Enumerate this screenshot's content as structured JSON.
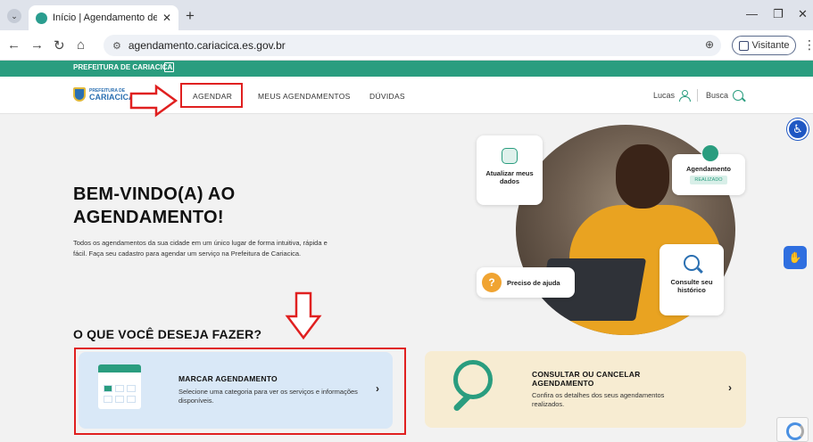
{
  "browser": {
    "tab_title": "Início | Agendamento de Cariac",
    "url": "agendamento.cariacica.es.gov.br",
    "profile_label": "Visitante"
  },
  "gov_bar": {
    "label": "PREFEITURA DE CARIACICA"
  },
  "logo": {
    "top": "PREFEITURA DE",
    "bottom": "CARIACICA"
  },
  "nav": {
    "items": [
      "AGENDAR",
      "MEUS AGENDAMENTOS",
      "DÚVIDAS"
    ],
    "user": "Lucas",
    "search": "Busca"
  },
  "hero": {
    "title_line1": "BEM-VINDO(A) AO",
    "title_line2": "AGENDAMENTO!",
    "description": "Todos os agendamentos da sua cidade em um único lugar de forma intuitiva, rápida e fácil. Faça seu cadastro para agendar um serviço na Prefeitura de Cariacica.",
    "cards": {
      "atualizar": "Atualizar meus dados",
      "agendamento": "Agendamento",
      "realizado": "REALIZADO",
      "consulte": "Consulte seu histórico",
      "ajuda": "Preciso de ajuda"
    }
  },
  "section": {
    "title": "O QUE VOCÊ DESEJA FAZER?",
    "marcar": {
      "title": "MARCAR AGENDAMENTO",
      "desc": "Selecione uma categoria para ver os serviços e informações disponíveis."
    },
    "consultar": {
      "title_line1": "CONSULTAR OU CANCELAR",
      "title_line2": "AGENDAMENTO",
      "desc": "Confira os detalhes dos seus agendamentos realizados."
    }
  },
  "colors": {
    "brand_green": "#2a9d7f",
    "annotation_red": "#e02020"
  }
}
